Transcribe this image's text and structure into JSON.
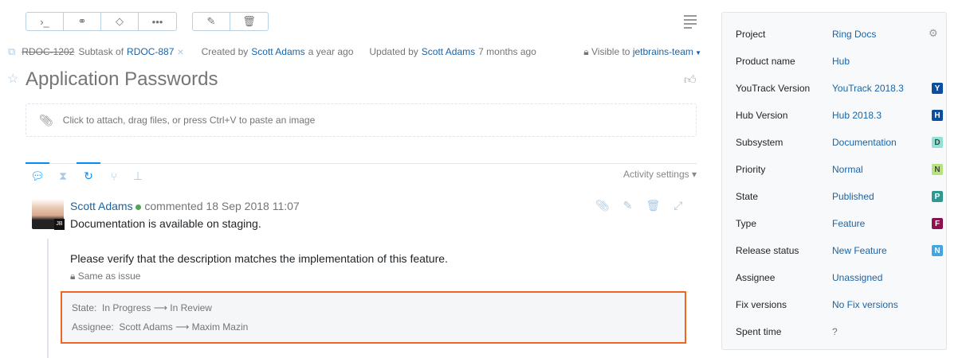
{
  "toolbar": {
    "command": "›_",
    "link": "🔗",
    "tag": "⌂",
    "more": "•••",
    "edit": "✎",
    "delete": "🗑"
  },
  "meta": {
    "issue_id": "RDOC-1202",
    "subtask_of_label": "Subtask of",
    "parent_id": "RDOC-887",
    "remove": "×",
    "created_label": "Created by",
    "created_by": "Scott Adams",
    "created_when": "a year ago",
    "updated_label": "Updated by",
    "updated_by": "Scott Adams",
    "updated_when": "7 months ago",
    "visible_label": "Visible to",
    "visible_group": "jetbrains-team"
  },
  "title": "Application Passwords",
  "attach_hint": "Click to attach, drag files, or press Ctrl+V to paste an image",
  "activity_settings": "Activity settings ▾",
  "comment": {
    "author": "Scott Adams",
    "action": "commented",
    "date": "18 Sep 2018 11:07",
    "line1": "Documentation is available on staging.",
    "line2": "Please verify that the description matches the implementation of this feature.",
    "visibility": "Same as issue",
    "avatar_badge": "JB"
  },
  "changes": [
    {
      "field": "State:",
      "from": "In Progress",
      "to": "In Review"
    },
    {
      "field": "Assignee:",
      "from": "Scott Adams",
      "to": "Maxim Mazin"
    }
  ],
  "fields": [
    {
      "label": "Project",
      "value": "Ring Docs"
    },
    {
      "label": "Product name",
      "value": "Hub"
    },
    {
      "label": "YouTrack Version",
      "value": "YouTrack 2018.3",
      "badge": "Y",
      "color": "#0b4f9e"
    },
    {
      "label": "Hub Version",
      "value": "Hub 2018.3",
      "badge": "H",
      "color": "#0b4f9e"
    },
    {
      "label": "Subsystem",
      "value": "Documentation",
      "badge": "D",
      "color": "#92e1d5",
      "fg": "#444"
    },
    {
      "label": "Priority",
      "value": "Normal",
      "badge": "N",
      "color": "#b7e281",
      "fg": "#444"
    },
    {
      "label": "State",
      "value": "Published",
      "badge": "P",
      "color": "#2f9890"
    },
    {
      "label": "Type",
      "value": "Feature",
      "badge": "F",
      "color": "#8d1051"
    },
    {
      "label": "Release status",
      "value": "New Feature",
      "badge": "N",
      "color": "#45a5e0"
    },
    {
      "label": "Assignee",
      "value": "Unassigned"
    },
    {
      "label": "Fix versions",
      "value": "No Fix versions"
    },
    {
      "label": "Spent time",
      "value": "?"
    }
  ]
}
